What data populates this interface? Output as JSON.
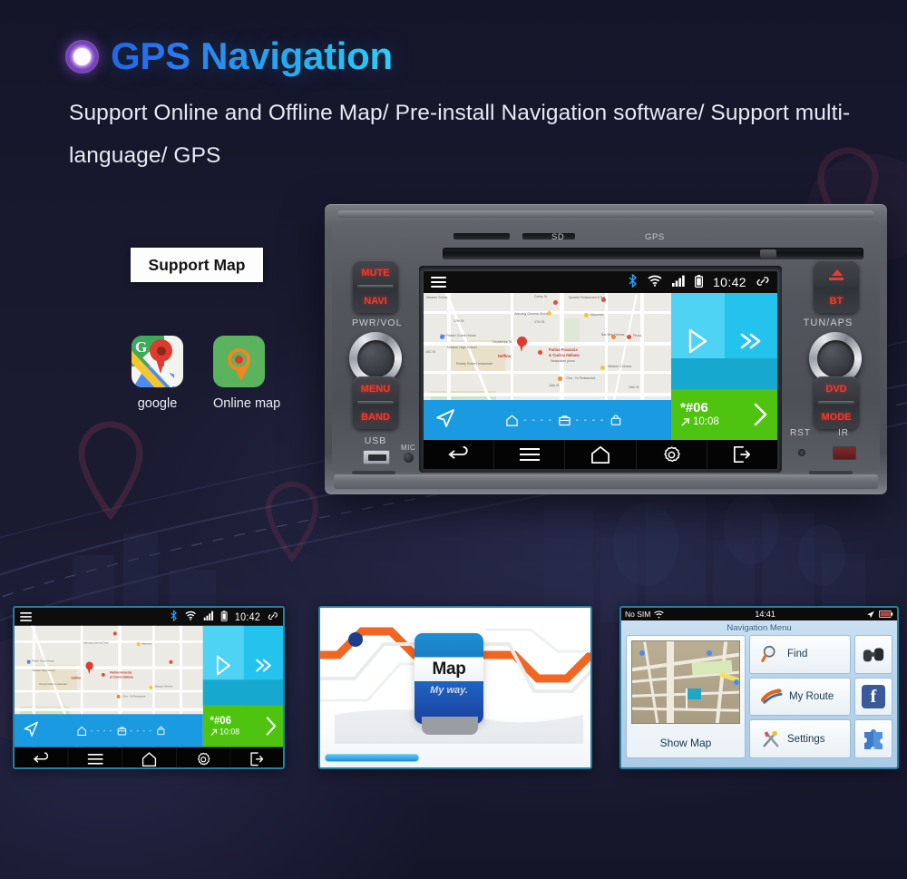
{
  "header": {
    "title": "GPS Navigation",
    "subtitle": "Support Online and Offline Map/ Pre-install Navigation software/ Support multi-language/ GPS",
    "accent_start": "#2462e8",
    "accent_end": "#2fd3f7",
    "background": "#17172b"
  },
  "support_map": {
    "badge_label": "Support Map",
    "apps": [
      {
        "label": "google",
        "icon": "google-maps-icon"
      },
      {
        "label": "Online map",
        "icon": "map-pin-icon"
      }
    ]
  },
  "head_unit": {
    "slot_labels": {
      "sd": "SD",
      "gps": "GPS"
    },
    "left_controls": {
      "rocker_top": "MUTE",
      "rocker_bottom": "NAVI",
      "knob_label": "PWR/VOL",
      "rocker2_top": "MENU",
      "rocker2_bottom": "BAND",
      "usb_label": "USB",
      "mic_label": "MIC"
    },
    "right_controls": {
      "eject_label": "BT",
      "knob_label": "TUN/APS",
      "rocker_top": "DVD",
      "rocker_bottom": "MODE",
      "reset_label": "RST",
      "ir_label": "IR"
    },
    "screen": {
      "statusbar": {
        "time": "10:42",
        "icons": [
          "bluetooth-icon",
          "wifi-icon",
          "signal-icon",
          "battery-icon",
          "link-icon"
        ]
      },
      "media_tile": {
        "play": "play-icon",
        "next": "fast-forward-icon"
      },
      "call_tile": {
        "number": "*#06",
        "time": "10:08",
        "arrow": "chevron-right-icon"
      },
      "blue_bar": {
        "nav_icon": "navigation-arrow-icon",
        "steps": [
          "home-icon",
          "briefcase-icon",
          "bag-icon"
        ],
        "dashes": "- - - -"
      },
      "navbar": [
        "back-icon",
        "menu-icon",
        "home-icon",
        "settings-icon",
        "exit-icon"
      ],
      "map_labels": [
        "Warning General Store",
        "17th St",
        "The Parkin Guest House",
        "Mission High School",
        "Delfina",
        "Farina Focaccia",
        "& Cucina Italiana",
        "Valencia Pizza & Pasta",
        "Mission Dolores Park",
        "Cha - Ya Restaurant",
        "Maverick",
        "Bar Bon Homes",
        "Pizza",
        "Mission Chinese",
        "Speedbis",
        "Occidental St",
        "Rowdy Robert restaurant"
      ]
    }
  },
  "thumbnails": [
    {
      "name": "head-unit-screen-thumb",
      "caption": "",
      "border_color": "#2b7f9e"
    },
    {
      "name": "map-my-way-splash-thumb",
      "brand": "Map",
      "tagline": "My way.",
      "trademark": "™",
      "border_color": "#2b7f9e"
    },
    {
      "name": "navigation-menu-thumb",
      "status_left": "No SIM",
      "status_time": "14:41",
      "screen_title": "Navigation Menu",
      "show_map": "Show Map",
      "menu_items": [
        {
          "label": "Find",
          "icon": "magnifier-icon"
        },
        {
          "label": "My Route",
          "icon": "route-icon"
        },
        {
          "label": "Settings",
          "icon": "tools-icon"
        }
      ],
      "side_icons": [
        "binoculars-icon",
        "facebook-icon",
        "puzzle-icon"
      ],
      "facebook_letter": "f",
      "border_color": "#2b7f9e"
    }
  ]
}
